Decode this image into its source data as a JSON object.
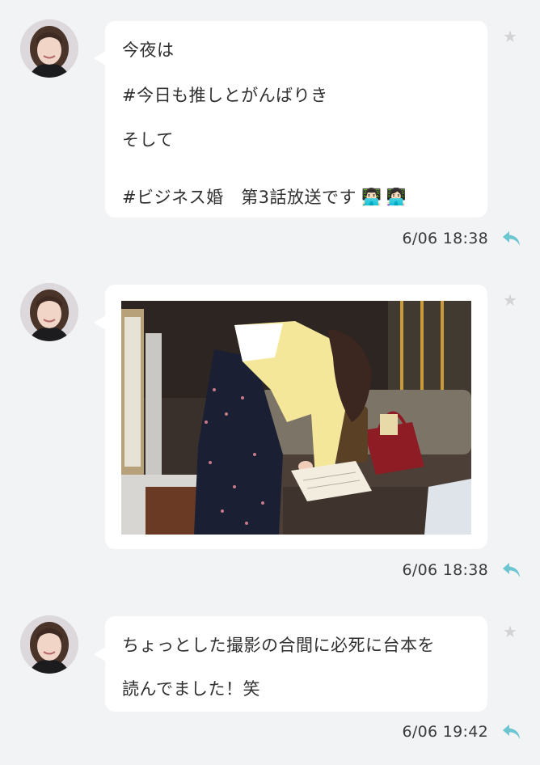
{
  "messages": [
    {
      "lines": [
        "今夜は",
        "#今日も推しとがんばりき",
        "そして",
        "#ビジネス婚　第3話放送です"
      ],
      "emoji": [
        "👨🏻‍💻",
        "👩🏻‍💻"
      ],
      "time": "6/06 18:38"
    },
    {
      "image": "photo-woman-bending-over-script-on-sofa",
      "time": "6/06 18:38"
    },
    {
      "lines": [
        "ちょっとした撮影の合間に必死に台本を",
        "読んでました！笑"
      ],
      "time": "6/06 19:42"
    }
  ],
  "icons": {
    "star": "star-icon",
    "reply": "reply-arrow-icon",
    "avatar": "user-avatar"
  },
  "colors": {
    "background": "#f2f3f5",
    "bubble": "#ffffff",
    "reply_accent": "#6cc6cf",
    "star": "#d3d3d6"
  }
}
